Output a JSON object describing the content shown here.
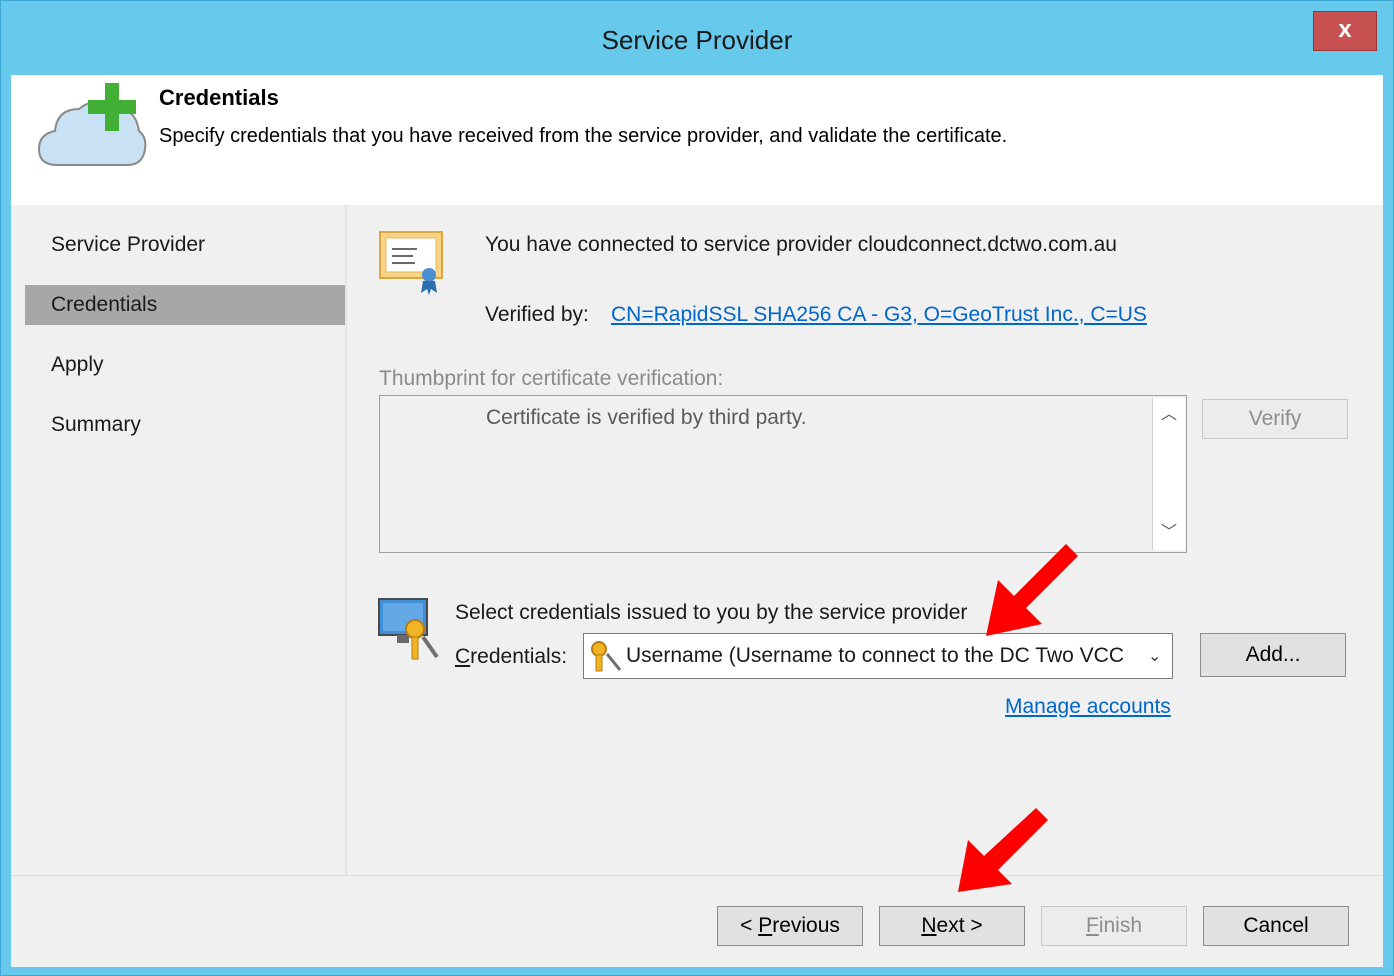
{
  "window": {
    "title": "Service Provider",
    "close_label": "x"
  },
  "header": {
    "title": "Credentials",
    "subtitle": "Specify credentials that you have received from the service provider, and validate the certificate.",
    "icon": "cloud-plus-icon"
  },
  "sidebar": {
    "items": [
      {
        "label": "Service Provider",
        "selected": false
      },
      {
        "label": "Credentials",
        "selected": true
      },
      {
        "label": "Apply",
        "selected": false
      },
      {
        "label": "Summary",
        "selected": false
      }
    ]
  },
  "main": {
    "connected_text": "You have connected to service provider cloudconnect.dctwo.com.au",
    "verified_by_label": "Verified by:",
    "verified_by_value": "CN=RapidSSL SHA256 CA - G3, O=GeoTrust Inc., C=US",
    "thumbprint_label": "Thumbprint for certificate verification:",
    "thumbprint_text": "Certificate is verified by third party.",
    "verify_button": "Verify",
    "select_credentials_text": "Select credentials issued to you by the service provider",
    "credentials_label": "Credentials:",
    "credentials_value": "Username (Username to connect to the DC Two VCC",
    "add_button": "Add...",
    "manage_accounts_link": "Manage accounts"
  },
  "footer": {
    "previous_button": "< Previous",
    "next_button": "Next >",
    "finish_button": "Finish",
    "cancel_button": "Cancel"
  },
  "colors": {
    "titlebar": "#67c9ec",
    "close": "#c75050",
    "link": "#0066cc",
    "annotation_arrow": "#ff0000"
  }
}
